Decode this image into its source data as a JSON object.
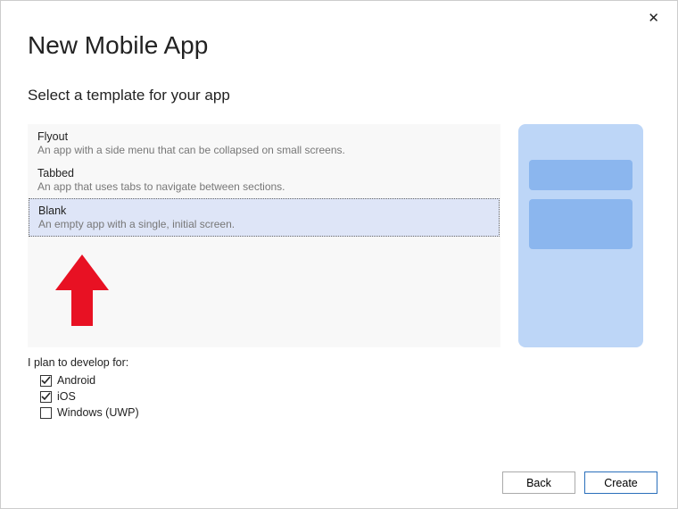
{
  "title": "New Mobile App",
  "subtitle": "Select a template for your app",
  "templates": [
    {
      "name": "Flyout",
      "desc": "An app with a side menu that can be collapsed on small screens."
    },
    {
      "name": "Tabbed",
      "desc": "An app that uses tabs to navigate between sections."
    },
    {
      "name": "Blank",
      "desc": "An empty app with a single, initial screen."
    }
  ],
  "selected_template_index": 2,
  "develop_for_label": "I plan to develop for:",
  "platforms": [
    {
      "label": "Android",
      "checked": true
    },
    {
      "label": "iOS",
      "checked": true
    },
    {
      "label": "Windows (UWP)",
      "checked": false
    }
  ],
  "buttons": {
    "back": "Back",
    "create": "Create"
  },
  "close_glyph": "✕"
}
